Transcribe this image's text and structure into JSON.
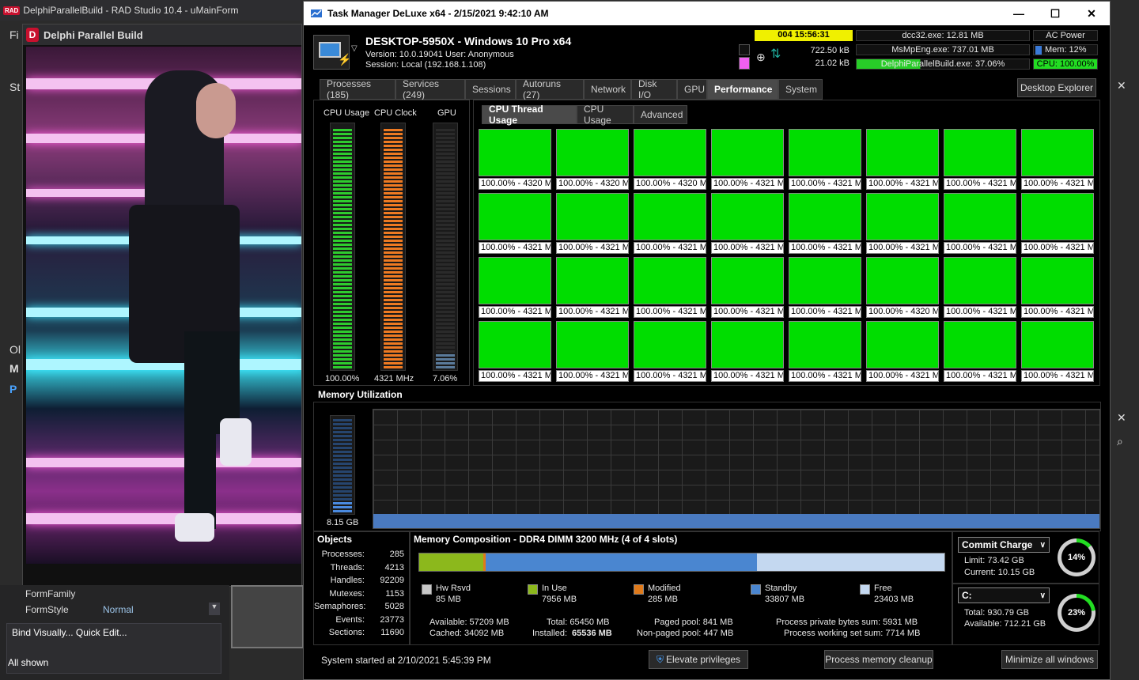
{
  "ide": {
    "title": "DelphiParallelBuild - RAD Studio 10.4 - uMainForm",
    "logo": "RAD",
    "left_labels": [
      "Fi",
      "St",
      "Ol",
      "M",
      "P"
    ]
  },
  "dpb": {
    "title": "Delphi Parallel Build",
    "logo": "D"
  },
  "props": {
    "rows": [
      {
        "name": "FormFamily",
        "value": ""
      },
      {
        "name": "FormStyle",
        "value": "Normal"
      }
    ],
    "bind_visually": "Bind Visually...  Quick Edit...",
    "all_shown": "All shown"
  },
  "tm": {
    "title": "Task Manager DeLuxe x64 - 2/15/2021 9:42:10 AM",
    "host": "DESKTOP-5950X - Windows 10 Pro x64",
    "version": "Version: 10.0.19041   User: Anonymous",
    "session": "Session: Local (192.168.1.108)",
    "uptime": "004 15:56:31",
    "net_up": "722.50 kB",
    "net_down": "21.02 kB",
    "procs": [
      "dcc32.exe: 12.81 MB",
      "MsMpEng.exe: 737.01 MB",
      "DelphiParallelBuild.exe: 37.06%"
    ],
    "power": "AC Power",
    "mem": "Mem: 12%",
    "cpu": "CPU: 100.00%",
    "tabs": [
      "Processes (185)",
      "Services (249)",
      "Sessions",
      "Autoruns (27)",
      "Network",
      "Disk I/O",
      "GPU",
      "Performance",
      "System"
    ],
    "active_tab": "Performance",
    "desktop_explorer": "Desktop Explorer",
    "gauges": [
      {
        "label": "CPU Usage",
        "value": "100.00%",
        "fraction": 1.0,
        "color": "#2ecc2e"
      },
      {
        "label": "CPU Clock",
        "value": "4321 MHz",
        "fraction": 1.0,
        "color": "#ee7a22"
      },
      {
        "label": "GPU",
        "value": "7.06%",
        "fraction": 0.07,
        "color": "#5a7a9a"
      }
    ],
    "subtabs": [
      "CPU Thread Usage",
      "CPU Usage",
      "Advanced"
    ],
    "threads": [
      "100.00% - 4320 M",
      "100.00% - 4320 M",
      "100.00% - 4320 M",
      "100.00% - 4321 M",
      "100.00% - 4321 M",
      "100.00% - 4321 M",
      "100.00% - 4321 M",
      "100.00% - 4321 M",
      "100.00% - 4321 M",
      "100.00% - 4321 M",
      "100.00% - 4321 M",
      "100.00% - 4321 M",
      "100.00% - 4321 M",
      "100.00% - 4321 M",
      "100.00% - 4321 M",
      "100.00% - 4321 M",
      "100.00% - 4321 M",
      "100.00% - 4321 M",
      "100.00% - 4321 M",
      "100.00% - 4321 M",
      "100.00% - 4321 M",
      "100.00% - 4320 M",
      "100.00% - 4321 M",
      "100.00% - 4321 M",
      "100.00% - 4321 M",
      "100.00% - 4321 M",
      "100.00% - 4321 M",
      "100.00% - 4321 M",
      "100.00% - 4321 M",
      "100.00% - 4321 M",
      "100.00% - 4321 M",
      "100.00% - 4321 M"
    ],
    "memory_title": "Memory Utilization",
    "memory_used": "8.15 GB",
    "memory_fraction": 0.12,
    "objects_title": "Objects",
    "objects": [
      {
        "k": "Processes:",
        "v": "285"
      },
      {
        "k": "Threads:",
        "v": "4213"
      },
      {
        "k": "Handles:",
        "v": "92209"
      },
      {
        "k": "Mutexes:",
        "v": "1153"
      },
      {
        "k": "Semaphores:",
        "v": "5028"
      },
      {
        "k": "Events:",
        "v": "23773"
      },
      {
        "k": "Sections:",
        "v": "11690"
      }
    ],
    "composition_title": "Memory Composition - DDR4 DIMM 3200 MHz (4 of 4 slots)",
    "composition": [
      {
        "name": "Hw Rsvd",
        "value": "85 MB",
        "color": "#c8c8c8"
      },
      {
        "name": "In Use",
        "value": "7956 MB",
        "color": "#8cb81c"
      },
      {
        "name": "Modified",
        "value": "285 MB",
        "color": "#e07a1a"
      },
      {
        "name": "Standby",
        "value": "33807 MB",
        "color": "#4a86d0"
      },
      {
        "name": "Free",
        "value": "23403 MB",
        "color": "#c4d8f0"
      }
    ],
    "available": "Available: 57209 MB",
    "cached": "Cached: 34092 MB",
    "total": "Total: 65450 MB",
    "installed_label": "Installed:",
    "installed": "65536 MB",
    "paged": "Paged pool: 841 MB",
    "nonpaged": "Non-paged pool: 447 MB",
    "private_sum": "Process private bytes sum: 5931 MB",
    "workingset_sum": "Process working set sum: 7714 MB",
    "commit_select": "Commit Charge",
    "commit_limit": "Limit: 73.42 GB",
    "commit_current": "Current: 10.15 GB",
    "commit_pct": "14%",
    "commit_fraction": 0.14,
    "drive_select": "C:",
    "drive_total": "Total: 930.79 GB",
    "drive_available": "Available: 712.21 GB",
    "drive_pct": "23%",
    "drive_fraction": 0.23,
    "system_started": "System started at 2/10/2021 5:45:39 PM",
    "elevate": "Elevate privileges",
    "cleanup": "Process memory cleanup",
    "minimize": "Minimize all windows"
  }
}
